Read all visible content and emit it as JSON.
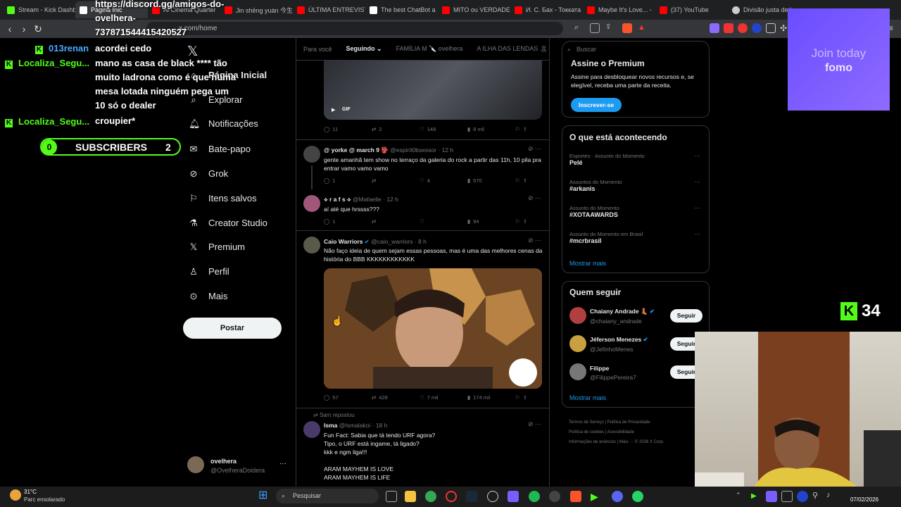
{
  "browser": {
    "tabs": [
      {
        "label": "Stream - Kick Dashb",
        "color": "#53fc18"
      },
      {
        "label": "Página Inic",
        "color": "#ffffff"
      },
      {
        "label": "Ai Cinema Quarter",
        "color": "#ff0000"
      },
      {
        "label": "Jin shēng yuán 今生",
        "color": "#ff0000"
      },
      {
        "label": "ÚLTIMA ENTREVIST",
        "color": "#ff0000"
      },
      {
        "label": "The best ChatBot a",
        "color": "#ffffff"
      },
      {
        "label": "MITO ou VERDADE",
        "color": "#ff0000"
      },
      {
        "label": "И. С. Бах - Токката",
        "color": "#ff0000"
      },
      {
        "label": "Maybe It's Love... -",
        "color": "#ff0000"
      },
      {
        "label": "(37) YouTube",
        "color": "#ff0000"
      },
      {
        "label": "Divisão justa de b",
        "color": "#cccccc"
      }
    ],
    "url": "x.com/home"
  },
  "overlay": {
    "discord_line1": "https://discord.gg/amigos-do-",
    "discord_line2": "ovelhera-",
    "discord_line3": "737871544415420527",
    "chat": [
      {
        "user": "013renan",
        "user_color": "#4aa8ff"
      },
      {
        "user": "Localiza_Segu...",
        "user_color": "#53fc18"
      },
      {
        "user": "Localiza_Segu...",
        "user_color": "#53fc18"
      }
    ],
    "msg1": "acordei cedo",
    "msg2_l1": "mano as casa de black **** tão",
    "msg2_l2": "muito ladrona como é que numa",
    "msg2_l3": "mesa lotada ninguém pega um",
    "msg2_l4": "10 só o dealer",
    "msg3": "croupier*",
    "subs_left": "0",
    "subs_label": "SUBSCRIBERS",
    "subs_right": "2",
    "promo_l1": "Join today",
    "promo_l2": "fomo",
    "kick_count": "34"
  },
  "sidebar": {
    "items": [
      {
        "label": "Página Inicial",
        "icon": "home-icon"
      },
      {
        "label": "Explorar",
        "icon": "search-icon"
      },
      {
        "label": "Notificações",
        "icon": "bell-icon"
      },
      {
        "label": "Bate-papo",
        "icon": "mail-icon"
      },
      {
        "label": "Grok",
        "icon": "grok-icon"
      },
      {
        "label": "Itens salvos",
        "icon": "bookmark-icon"
      },
      {
        "label": "Creator Studio",
        "icon": "flask-icon"
      },
      {
        "label": "Premium",
        "icon": "x-icon"
      },
      {
        "label": "Perfil",
        "icon": "person-icon"
      },
      {
        "label": "Mais",
        "icon": "more-icon"
      }
    ],
    "post_label": "Postar",
    "account_name": "ovelhera",
    "account_handle": "@OvelheraDoidera"
  },
  "timeline": {
    "tabs": [
      "Para você",
      "Seguindo",
      "FAMÍLIA M 🔪 ovelhera",
      "A ILHA DAS LENDAS 🏝"
    ],
    "gif_label": "GIF",
    "tweet0_actions": [
      "11",
      "2",
      "148",
      "8 mil"
    ],
    "tweet1": {
      "name": "@ yorke @ march 9 👺",
      "handle": "@espirit0bsessor · 12 h",
      "text": "gente amanhã tem show no terraço da galeria do rock a partir das 11h, 10 pila pra entrar vamo vamo vamo",
      "actions": [
        "1",
        "",
        "4",
        "570"
      ]
    },
    "tweet2": {
      "name": "⟡ r a f s ⟡",
      "handle": "@Mafaelle · 12 h",
      "text": "aí até que hrssss???",
      "actions": [
        "1",
        "",
        "",
        "94"
      ]
    },
    "tweet3": {
      "name": "Caio Warriors",
      "handle": "@caio_warriors · 8 h",
      "text": "Não faço ideia de quem sejam essas pessoas, mas é uma das melhores cenas da história do BBB KKKKKKKKKKKK",
      "actions": [
        "57",
        "428",
        "7 mil",
        "174 mil"
      ]
    },
    "tweet4": {
      "repost": "Sam repostou",
      "name": "Isma",
      "handle": "@Ismalakoi · 18 h",
      "l1": "Fun Fact: Sabia que tá tendo URF agora?",
      "l2": "Tipo, o URF está ingame, tá ligado?",
      "l3": "kkk e ngm liga!!!",
      "l4": "ARAM MAYHEM IS LOVE",
      "l5": "ARAM MAYHEM IS LIFE"
    }
  },
  "right": {
    "search_placeholder": "Buscar",
    "premium": {
      "title": "Assine o Premium",
      "text": "Assine para desbloquear novos recursos e, se elegível, receba uma parte da receita.",
      "button": "Inscrever-se"
    },
    "trends_title": "O que está acontecendo",
    "trends": [
      {
        "category": "Esportes · Assunto do Momento",
        "name": "Pelé"
      },
      {
        "category": "Assuntos do Momento",
        "name": "#arkanis"
      },
      {
        "category": "Assunto do Momento",
        "name": "#XOTAAWARDS"
      },
      {
        "category": "Assunto do Momento em Brasil",
        "name": "#mcrbrasil"
      }
    ],
    "show_more": "Mostrar mais",
    "follow_title": "Quem seguir",
    "follow": [
      {
        "name": "Chaiany Andrade 👢",
        "handle": "@chaiany_andrade"
      },
      {
        "name": "Jéferson Menezes",
        "handle": "@JefinhoMenes"
      },
      {
        "name": "Filippe",
        "handle": "@FilippePereira7"
      }
    ],
    "follow_label": "Seguir",
    "footer_l1": "Termos de Serviço  |  Política de Privacidade",
    "footer_l2": "Política de cookies  |  Acessibilidade",
    "footer_l3": "Informações de anúncios  |  Mais ···  © 2026 X Corp."
  },
  "taskbar": {
    "temp": "31°C",
    "weather": "Parc ensolarado",
    "search": "Pesquisar",
    "date": "07/02/2026"
  }
}
